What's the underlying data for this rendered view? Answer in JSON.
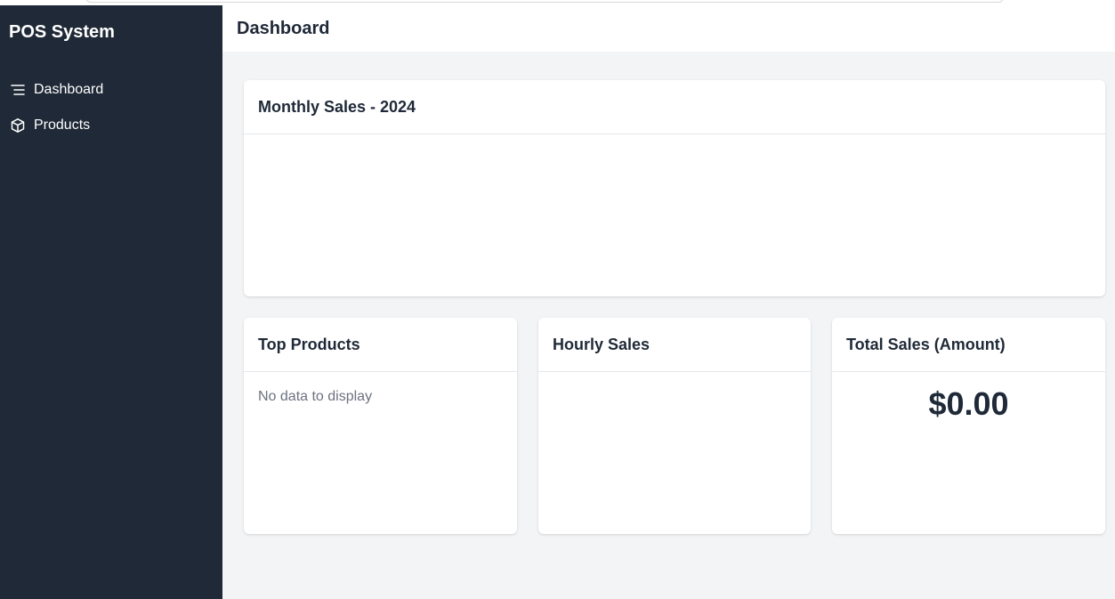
{
  "sidebar": {
    "brand": "POS System",
    "items": [
      {
        "label": "Dashboard",
        "icon": "menu-lines-icon"
      },
      {
        "label": "Products",
        "icon": "box-icon"
      }
    ]
  },
  "header": {
    "title": "Dashboard"
  },
  "cards": {
    "monthly_sales": {
      "title": "Monthly Sales - 2024"
    },
    "top_products": {
      "title": "Top Products",
      "empty_text": "No data to display"
    },
    "hourly_sales": {
      "title": "Hourly Sales"
    },
    "total_sales": {
      "title": "Total Sales (Amount)",
      "amount": "$0.00"
    }
  },
  "colors": {
    "sidebar_bg": "#1f2937",
    "page_bg": "#f3f4f6",
    "card_bg": "#ffffff",
    "text_primary": "#1f2937",
    "text_muted": "#6b7280"
  }
}
